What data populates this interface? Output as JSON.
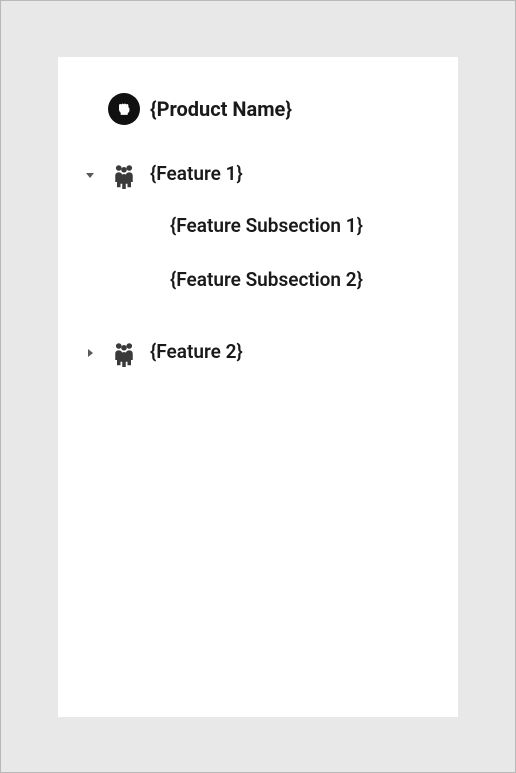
{
  "product": {
    "name": "{Product Name}"
  },
  "tree": {
    "items": [
      {
        "label": "{Feature 1}",
        "expanded": true,
        "children": [
          {
            "label": "{Feature Subsection 1}"
          },
          {
            "label": "{Feature Subsection 2}"
          }
        ]
      },
      {
        "label": "{Feature 2}",
        "expanded": false,
        "children": []
      }
    ]
  }
}
